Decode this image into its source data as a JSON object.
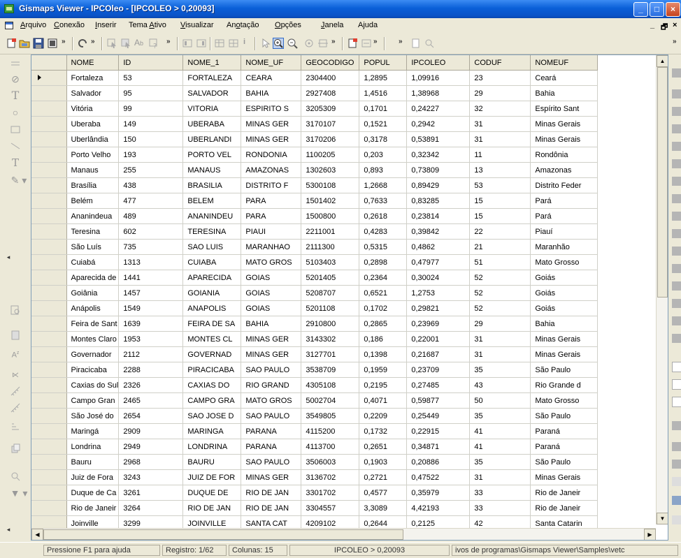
{
  "window": {
    "title": "Gismaps Viewer - IPCOleo - [IPCOLEO > 0,20093]",
    "buttons": [
      "_",
      "□",
      "×"
    ]
  },
  "menu": {
    "items": [
      {
        "pre": "",
        "ul": "A",
        "post": "rquivo"
      },
      {
        "pre": "",
        "ul": "C",
        "post": "onexão"
      },
      {
        "pre": "",
        "ul": "I",
        "post": "nserir"
      },
      {
        "pre": "Tema ",
        "ul": "A",
        "post": "tivo"
      },
      {
        "pre": "",
        "ul": "V",
        "post": "isualizar"
      },
      {
        "pre": "An",
        "ul": "o",
        "post": "tação"
      },
      {
        "pre": "",
        "ul": "O",
        "post": "pções"
      },
      {
        "pre": "",
        "ul": "J",
        "post": "anela"
      },
      {
        "pre": "A",
        "ul": "j",
        "post": "uda"
      }
    ],
    "mdi_controls": [
      "_",
      "🗗",
      "×"
    ]
  },
  "grid": {
    "columns": [
      "NOME",
      "ID",
      "NOME_1",
      "NOME_UF",
      "GEOCODIGO",
      "POPUL",
      "IPCOLEO",
      "CODUF",
      "NOMEUF"
    ],
    "rows": [
      [
        "Fortaleza",
        "53",
        "FORTALEZA",
        "CEARA",
        "2304400",
        "1,2895",
        "1,09916",
        "23",
        "Ceará"
      ],
      [
        "Salvador",
        "95",
        "SALVADOR",
        "BAHIA",
        "2927408",
        "1,4516",
        "1,38968",
        "29",
        "Bahia"
      ],
      [
        "Vitória",
        "99",
        "VITORIA",
        "ESPIRITO S",
        "3205309",
        "0,1701",
        "0,24227",
        "32",
        "Espírito Sant"
      ],
      [
        "Uberaba",
        "149",
        "UBERABA",
        "MINAS GER",
        "3170107",
        "0,1521",
        "0,2942",
        "31",
        "Minas Gerais"
      ],
      [
        "Uberlândia",
        "150",
        "UBERLANDI",
        "MINAS GER",
        "3170206",
        "0,3178",
        "0,53891",
        "31",
        "Minas Gerais"
      ],
      [
        "Porto Velho",
        "193",
        "PORTO VEL",
        "RONDONIA",
        "1100205",
        "0,203",
        "0,32342",
        "11",
        "Rondônia"
      ],
      [
        "Manaus",
        "255",
        "MANAUS",
        "AMAZONAS",
        "1302603",
        "0,893",
        "0,73809",
        "13",
        "Amazonas"
      ],
      [
        "Brasília",
        "438",
        "BRASILIA",
        "DISTRITO F",
        "5300108",
        "1,2668",
        "0,89429",
        "53",
        "Distrito Feder"
      ],
      [
        "Belém",
        "477",
        "BELEM",
        "PARA",
        "1501402",
        "0,7633",
        "0,83285",
        "15",
        "Pará"
      ],
      [
        "Ananindeua",
        "489",
        "ANANINDEU",
        "PARA",
        "1500800",
        "0,2618",
        "0,23814",
        "15",
        "Pará"
      ],
      [
        "Teresina",
        "602",
        "TERESINA",
        "PIAUI",
        "2211001",
        "0,4283",
        "0,39842",
        "22",
        "Piauí"
      ],
      [
        "São Luís",
        "735",
        "SAO LUIS",
        "MARANHAO",
        "2111300",
        "0,5315",
        "0,4862",
        "21",
        "Maranhão"
      ],
      [
        "Cuiabá",
        "1313",
        "CUIABA",
        "MATO GROS",
        "5103403",
        "0,2898",
        "0,47977",
        "51",
        "Mato Grosso"
      ],
      [
        "Aparecida de",
        "1441",
        "APARECIDA",
        "GOIAS",
        "5201405",
        "0,2364",
        "0,30024",
        "52",
        "Goiás"
      ],
      [
        "Goiânia",
        "1457",
        "GOIANIA",
        "GOIAS",
        "5208707",
        "0,6521",
        "1,2753",
        "52",
        "Goiás"
      ],
      [
        "Anápolis",
        "1549",
        "ANAPOLIS",
        "GOIAS",
        "5201108",
        "0,1702",
        "0,29821",
        "52",
        "Goiás"
      ],
      [
        "Feira de Sant",
        "1639",
        "FEIRA DE SA",
        "BAHIA",
        "2910800",
        "0,2865",
        "0,23969",
        "29",
        "Bahia"
      ],
      [
        "Montes Claro",
        "1953",
        "MONTES CL",
        "MINAS GER",
        "3143302",
        "0,186",
        "0,22001",
        "31",
        "Minas Gerais"
      ],
      [
        "Governador",
        "2112",
        "GOVERNAD",
        "MINAS GER",
        "3127701",
        "0,1398",
        "0,21687",
        "31",
        "Minas Gerais"
      ],
      [
        "Piracicaba",
        "2288",
        "PIRACICABA",
        "SAO PAULO",
        "3538709",
        "0,1959",
        "0,23709",
        "35",
        "São Paulo"
      ],
      [
        "Caxias do Sul",
        "2326",
        "CAXIAS DO",
        "RIO GRAND",
        "4305108",
        "0,2195",
        "0,27485",
        "43",
        "Rio Grande d"
      ],
      [
        "Campo Gran",
        "2465",
        "CAMPO GRA",
        "MATO GROS",
        "5002704",
        "0,4071",
        "0,59877",
        "50",
        "Mato Grosso"
      ],
      [
        "São José do",
        "2654",
        "SAO JOSE D",
        "SAO PAULO",
        "3549805",
        "0,2209",
        "0,25449",
        "35",
        "São Paulo"
      ],
      [
        "Maringá",
        "2909",
        "MARINGA",
        "PARANA",
        "4115200",
        "0,1732",
        "0,22915",
        "41",
        "Paraná"
      ],
      [
        "Londrina",
        "2949",
        "LONDRINA",
        "PARANA",
        "4113700",
        "0,2651",
        "0,34871",
        "41",
        "Paraná"
      ],
      [
        "Bauru",
        "2968",
        "BAURU",
        "SAO PAULO",
        "3506003",
        "0,1903",
        "0,20886",
        "35",
        "São Paulo"
      ],
      [
        "Juiz de Fora",
        "3243",
        "JUIZ DE FOR",
        "MINAS GER",
        "3136702",
        "0,2721",
        "0,47522",
        "31",
        "Minas Gerais"
      ],
      [
        "Duque de Ca",
        "3261",
        "DUQUE DE",
        "RIO DE JAN",
        "3301702",
        "0,4577",
        "0,35979",
        "33",
        "Rio de Janeir"
      ],
      [
        "Rio de Janeir",
        "3264",
        "RIO DE JAN",
        "RIO DE JAN",
        "3304557",
        "3,3089",
        "4,42193",
        "33",
        "Rio de Janeir"
      ],
      [
        "Joinville",
        "3299",
        "JOINVILLE",
        "SANTA CAT",
        "4209102",
        "0,2644",
        "0,2125",
        "42",
        "Santa Catarin"
      ]
    ]
  },
  "status": {
    "help": "Pressione F1 para ajuda",
    "record": "Registro: 1/62",
    "columns": "Colunas: 15",
    "filter": "IPCOLEO > 0,20093",
    "path": "ivos de programas\\Gismaps Viewer\\Samples\\vetc"
  }
}
